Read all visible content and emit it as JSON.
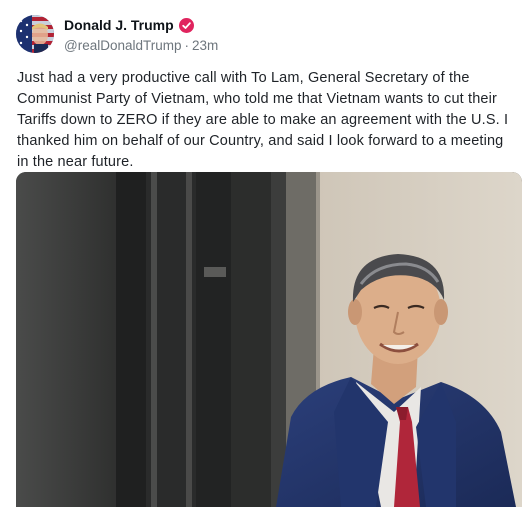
{
  "post": {
    "author": {
      "display_name": "Donald J. Trump",
      "handle": "@realDonaldTrump",
      "separator": "·",
      "timestamp": "23m",
      "verified_icon": "verified-badge-icon"
    },
    "text": "Just had a very productive call with To Lam, General Secretary of the Communist Party of Vietnam, who told me that Vietnam wants to cut their Tariffs down to ZERO if they are able to make an agreement with the U.S. I thanked him on behalf of our Country, and said I look forward to a meeting in the near future.",
    "media": {
      "type": "photo"
    }
  },
  "colors": {
    "verified": "#e0245e",
    "meta_text": "#6e767d",
    "body_text": "#1f2328"
  }
}
